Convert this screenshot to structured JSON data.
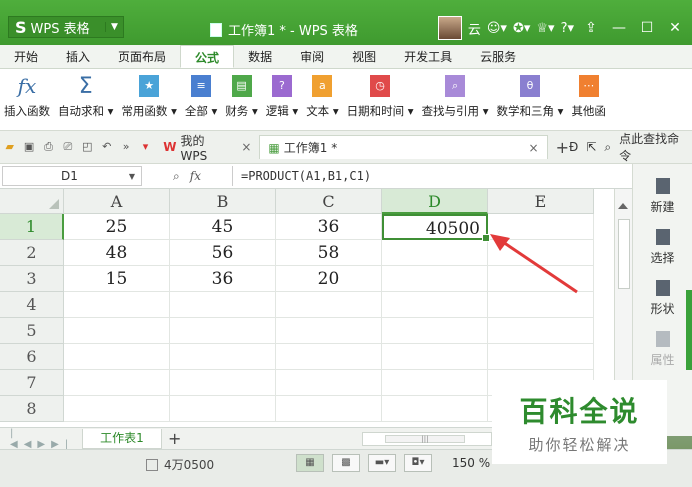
{
  "app": {
    "logo_text": "WPS 表格",
    "window_title": "工作簿1 * - WPS 表格",
    "user_name": "云"
  },
  "ribbon_tabs": [
    "开始",
    "插入",
    "页面布局",
    "公式",
    "数据",
    "审阅",
    "视图",
    "开发工具",
    "云服务"
  ],
  "ribbon_active_tab": "公式",
  "ribbon_buttons": [
    {
      "label": "插入函数",
      "icon": "fx-icon"
    },
    {
      "label": "自动求和 ▾",
      "icon": "sigma-icon"
    },
    {
      "label": "常用函数 ▾",
      "icon": "star-icon"
    },
    {
      "label": "全部 ▾",
      "icon": "list-icon"
    },
    {
      "label": "财务 ▾",
      "icon": "finance-icon"
    },
    {
      "label": "逻辑 ▾",
      "icon": "question-icon"
    },
    {
      "label": "文本 ▾",
      "icon": "text-icon"
    },
    {
      "label": "日期和时间 ▾",
      "icon": "clock-icon"
    },
    {
      "label": "查找与引用 ▾",
      "icon": "search-icon"
    },
    {
      "label": "数学和三角 ▾",
      "icon": "theta-icon"
    },
    {
      "label": "其他函",
      "icon": "more-icon"
    }
  ],
  "doc_tabs": [
    {
      "label": "我的WPS"
    },
    {
      "label": "工作簿1 *"
    }
  ],
  "search_command": "点此查找命令",
  "formula_bar": {
    "name_box": "D1",
    "fx_label": "fx",
    "formula": "=PRODUCT(A1,B1,C1)"
  },
  "grid": {
    "columns": [
      "A",
      "B",
      "C",
      "D",
      "E"
    ],
    "rows": [
      {
        "n": "1",
        "cells": [
          "25",
          "45",
          "36",
          "40500",
          ""
        ]
      },
      {
        "n": "2",
        "cells": [
          "48",
          "56",
          "58",
          "",
          ""
        ]
      },
      {
        "n": "3",
        "cells": [
          "15",
          "36",
          "20",
          "",
          ""
        ]
      },
      {
        "n": "4",
        "cells": [
          "",
          "",
          "",
          "",
          ""
        ]
      },
      {
        "n": "5",
        "cells": [
          "",
          "",
          "",
          "",
          ""
        ]
      },
      {
        "n": "6",
        "cells": [
          "",
          "",
          "",
          "",
          ""
        ]
      },
      {
        "n": "7",
        "cells": [
          "",
          "",
          "",
          "",
          ""
        ]
      },
      {
        "n": "8",
        "cells": [
          "",
          "",
          "",
          "",
          ""
        ]
      }
    ],
    "active_cell": "D1"
  },
  "task_panel": [
    "新建",
    "选择",
    "形状",
    "属性"
  ],
  "sheet_tab": "工作表1",
  "status": {
    "sum": "4万0500",
    "zoom": "150 %"
  },
  "watermark": {
    "main": "百科全说",
    "sub": "助你轻松解决"
  },
  "colors": {
    "accent": "#3f9a2f",
    "arrow": "#e23a3a"
  }
}
